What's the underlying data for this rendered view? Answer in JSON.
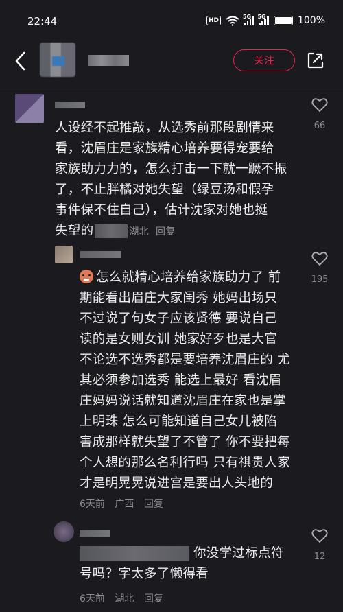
{
  "status_bar": {
    "time": "22:44",
    "hd": "HD",
    "signal1": "5G",
    "signal2": "5G",
    "battery": "100%"
  },
  "header": {
    "follow_label": "关注"
  },
  "comments": [
    {
      "text_lines": [
        "人设经不起推敲，从选秀前那段剧情来",
        "看，沈眉庄是家族精心培养要得宠要给",
        "家族助力力的，怎么打击一下就一蹶不振",
        "了，不止胖橘对她失望（绿豆汤和假孕",
        "事件保不住自己），估计沈家对她也挺",
        "失望的"
      ],
      "location": "湖北",
      "reply_label": "回复",
      "likes": "66"
    },
    {
      "text_lines": [
        "怎么就精心培养给家族助力了 前",
        "期能看出眉庄大家闺秀 她妈出场只",
        "不过说了句女子应该贤德 要说自己",
        "读的是女则女训 她家好歹也是大官",
        "不论选不选秀都是要培养沈眉庄的 尤",
        "其必须参加选秀 能选上最好 看沈眉",
        "庄妈妈说话就知道沈眉庄在家也是掌",
        "上明珠 怎么可能知道自己女儿被陷",
        "害成那样就失望了不管了 你不要把每",
        "个人想的那么名利行吗 只有祺贵人家",
        "才是明晃晃说进宫是要出人头地的"
      ],
      "time": "6天前",
      "location": "广西",
      "reply_label": "回复",
      "likes": "195"
    },
    {
      "text_lines": [
        "你没学过标点符",
        "号吗？字太多了懒得看"
      ],
      "time": "6天前",
      "location": "湖北",
      "reply_label": "回复",
      "likes": "12"
    }
  ]
}
